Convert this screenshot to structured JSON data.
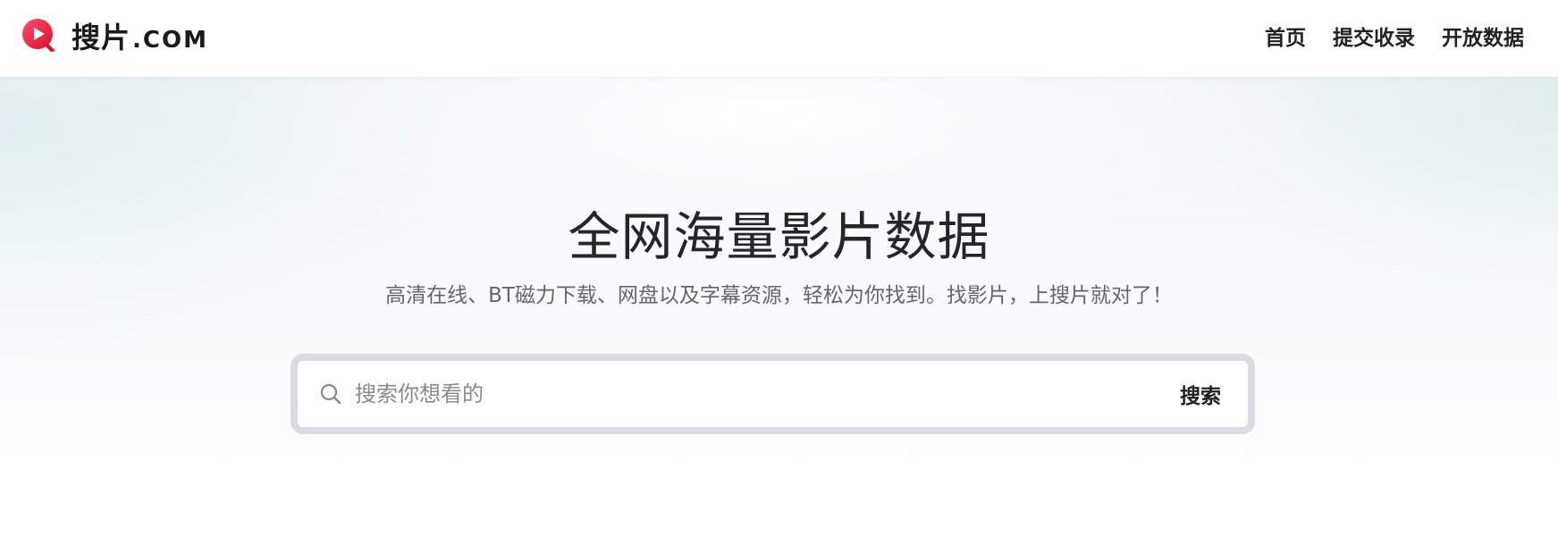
{
  "header": {
    "logo": {
      "text_cn": "搜片",
      "text_domain": ".COM",
      "icon": "play-circle-logo-icon",
      "brand_color": "#e8203a"
    },
    "nav": [
      {
        "label": "首页"
      },
      {
        "label": "提交收录"
      },
      {
        "label": "开放数据"
      }
    ]
  },
  "hero": {
    "title": "全网海量影片数据",
    "subtitle": "高清在线、BT磁力下载、网盘以及字幕资源，轻松为你找到。找影片，上搜片就对了！"
  },
  "search": {
    "placeholder": "搜索你想看的",
    "value": "",
    "button_label": "搜索",
    "icon": "search-icon",
    "border_color": "#d9dce1"
  }
}
